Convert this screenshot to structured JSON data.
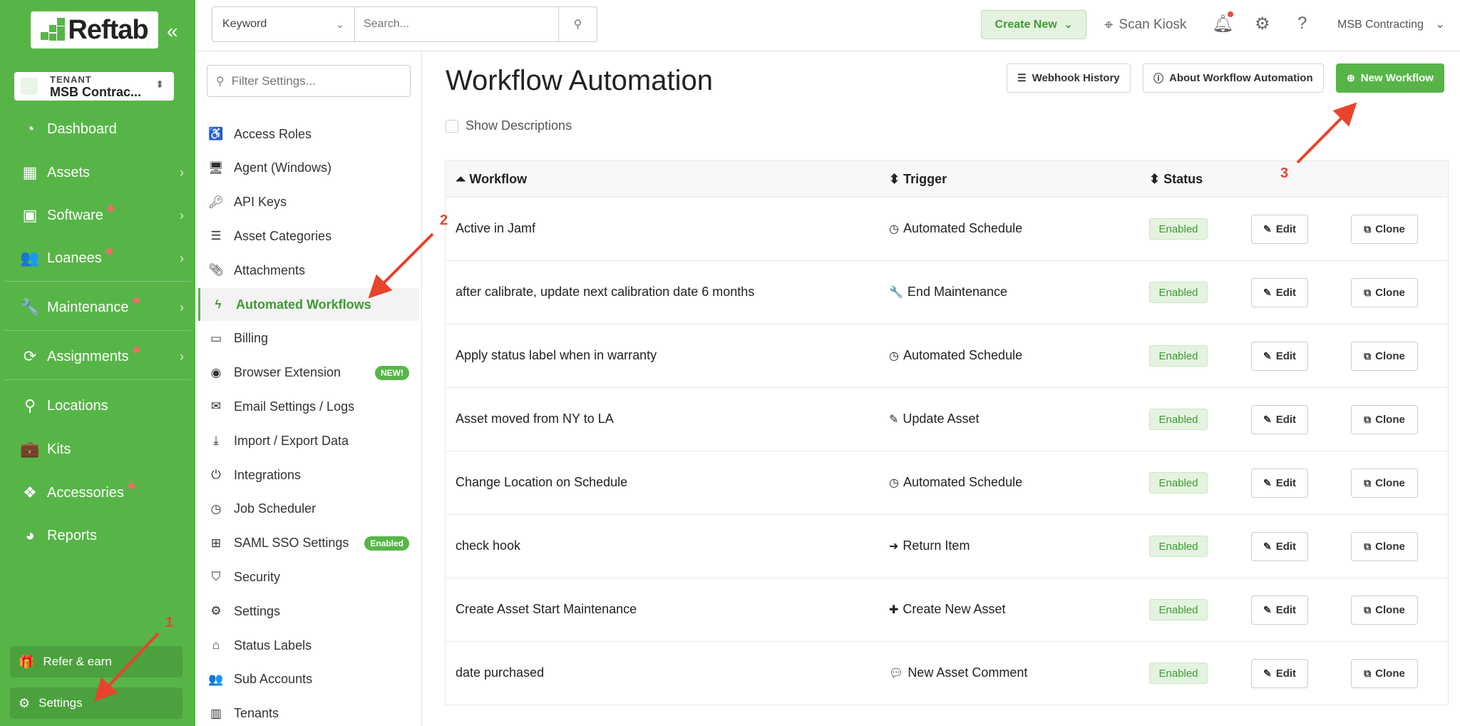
{
  "brand": {
    "logo_text": "Reftab"
  },
  "tenant": {
    "label": "TENANT",
    "value": "MSB Contrac..."
  },
  "nav": {
    "items": [
      {
        "label": "Dashboard",
        "icon": "dashboard-icon",
        "chevron": false,
        "dot": false
      },
      {
        "label": "Assets",
        "icon": "grid-icon",
        "chevron": true,
        "dot": false
      },
      {
        "label": "Software",
        "icon": "save-icon",
        "chevron": true,
        "dot": true
      },
      {
        "label": "Loanees",
        "icon": "users-icon",
        "chevron": true,
        "dot": true
      },
      {
        "label": "Maintenance",
        "icon": "wrench-icon",
        "chevron": true,
        "dot": true
      },
      {
        "label": "Assignments",
        "icon": "refresh-icon",
        "chevron": true,
        "dot": true
      },
      {
        "label": "Locations",
        "icon": "map-marker-icon",
        "chevron": false,
        "dot": false
      },
      {
        "label": "Kits",
        "icon": "briefcase-icon",
        "chevron": false,
        "dot": false
      },
      {
        "label": "Accessories",
        "icon": "cubes-icon",
        "chevron": false,
        "dot": true
      },
      {
        "label": "Reports",
        "icon": "pie-chart-icon",
        "chevron": false,
        "dot": false
      }
    ],
    "refer_label": "Refer & earn",
    "settings_label": "Settings"
  },
  "topbar": {
    "search_type": "Keyword",
    "search_placeholder": "Search...",
    "create_new": "Create New",
    "scan_kiosk": "Scan Kiosk",
    "account": "MSB Contracting"
  },
  "settings_nav": {
    "filter_placeholder": "Filter Settings...",
    "items": [
      {
        "label": "Access Roles",
        "icon": "universal-access-icon"
      },
      {
        "label": "Agent (Windows)",
        "icon": "desktop-icon"
      },
      {
        "label": "API Keys",
        "icon": "key-icon"
      },
      {
        "label": "Asset Categories",
        "icon": "list-icon"
      },
      {
        "label": "Attachments",
        "icon": "paperclip-icon"
      },
      {
        "label": "Automated Workflows",
        "icon": "bolt-icon",
        "active": true
      },
      {
        "label": "Billing",
        "icon": "credit-card-icon"
      },
      {
        "label": "Browser Extension",
        "icon": "chrome-icon",
        "badge": "NEW!"
      },
      {
        "label": "Email Settings / Logs",
        "icon": "envelope-icon"
      },
      {
        "label": "Import / Export Data",
        "icon": "download-icon"
      },
      {
        "label": "Integrations",
        "icon": "plug-icon"
      },
      {
        "label": "Job Scheduler",
        "icon": "clock-icon"
      },
      {
        "label": "SAML SSO Settings",
        "icon": "sitemap-icon",
        "badge": "Enabled"
      },
      {
        "label": "Security",
        "icon": "shield-icon"
      },
      {
        "label": "Settings",
        "icon": "cogs-icon"
      },
      {
        "label": "Status Labels",
        "icon": "tags-icon"
      },
      {
        "label": "Sub Accounts",
        "icon": "users-icon"
      },
      {
        "label": "Tenants",
        "icon": "building-icon"
      }
    ]
  },
  "main": {
    "title": "Workflow Automation",
    "webhook_history": "Webhook History",
    "about": "About Workflow Automation",
    "new_workflow": "New Workflow",
    "show_descriptions": "Show Descriptions",
    "columns": {
      "workflow": "Workflow",
      "trigger": "Trigger",
      "status": "Status"
    },
    "edit_label": "Edit",
    "clone_label": "Clone",
    "rows": [
      {
        "workflow": "Active in Jamf",
        "trigger": "Automated Schedule",
        "trigger_icon": "clock-icon",
        "status": "Enabled"
      },
      {
        "workflow": "after calibrate, update next calibration date 6 months",
        "trigger": "End Maintenance",
        "trigger_icon": "wrench-icon",
        "status": "Enabled"
      },
      {
        "workflow": "Apply status label when in warranty",
        "trigger": "Automated Schedule",
        "trigger_icon": "clock-icon",
        "status": "Enabled"
      },
      {
        "workflow": "Asset moved from NY to LA",
        "trigger": "Update Asset",
        "trigger_icon": "edit-icon",
        "status": "Enabled"
      },
      {
        "workflow": "Change Location on Schedule",
        "trigger": "Automated Schedule",
        "trigger_icon": "clock-icon",
        "status": "Enabled"
      },
      {
        "workflow": "check hook",
        "trigger": "Return Item",
        "trigger_icon": "sign-in-icon",
        "status": "Enabled"
      },
      {
        "workflow": "Create Asset Start Maintenance",
        "trigger": "Create New Asset",
        "trigger_icon": "plus-icon",
        "status": "Enabled"
      },
      {
        "workflow": "date purchased",
        "trigger": "New Asset Comment",
        "trigger_icon": "comment-icon",
        "status": "Enabled"
      }
    ]
  },
  "annotations": {
    "a1": "1",
    "a2": "2",
    "a3": "3"
  },
  "colors": {
    "brand_green": "#57b548",
    "annotation_red": "#e8432c",
    "notification_dot": "#f16b6b"
  }
}
